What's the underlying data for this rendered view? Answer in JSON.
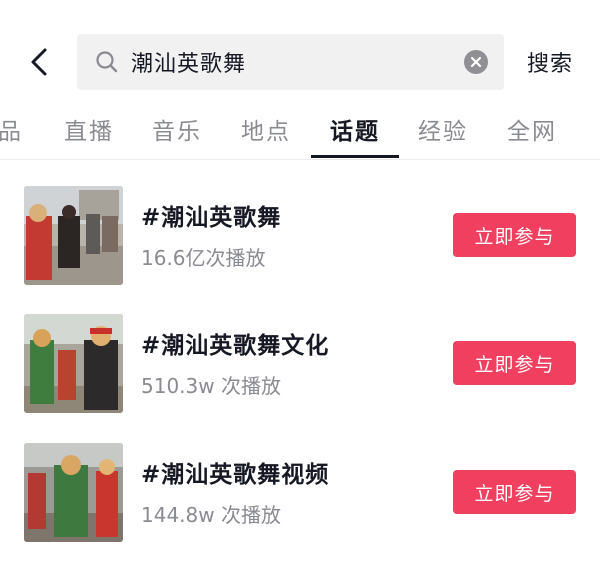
{
  "header": {
    "back_icon": "chevron-left-icon",
    "search": {
      "value": "潮汕英歌舞",
      "icon": "search-icon",
      "clear_icon": "clear-icon"
    },
    "submit_label": "搜索"
  },
  "tabs": [
    {
      "label": "品",
      "active": false
    },
    {
      "label": "直播",
      "active": false
    },
    {
      "label": "音乐",
      "active": false
    },
    {
      "label": "地点",
      "active": false
    },
    {
      "label": "话题",
      "active": true
    },
    {
      "label": "经验",
      "active": false
    },
    {
      "label": "全网",
      "active": false
    }
  ],
  "topics": [
    {
      "title": "#潮汕英歌舞",
      "views": "16.6亿次播放",
      "button_label": "立即参与"
    },
    {
      "title": "#潮汕英歌舞文化",
      "views": "510.3w 次播放",
      "button_label": "立即参与"
    },
    {
      "title": "#潮汕英歌舞视频",
      "views": "144.8w 次播放",
      "button_label": "立即参与"
    }
  ],
  "colors": {
    "accent": "#f03f5f",
    "text_primary": "#161823",
    "text_secondary": "#8a8b91",
    "search_bg": "#f1f1f2"
  }
}
